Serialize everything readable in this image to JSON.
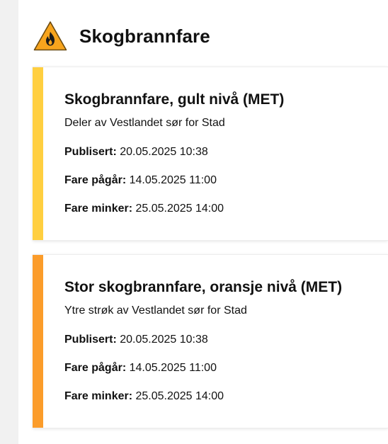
{
  "header": {
    "title": "Skogbrannfare",
    "icon": "fire-warning-icon"
  },
  "colors": {
    "yellow": "#ffcf40",
    "orange": "#fb9c2a",
    "icon_fill": "#f7a41d"
  },
  "warnings": [
    {
      "title": "Skogbrannfare, gult nivå (MET)",
      "area": "Deler av Vestlandet sør for Stad",
      "level_color": "yellow",
      "published_label": "Publisert:",
      "published_value": "20.05.2025 10:38",
      "ongoing_label": "Fare pågår:",
      "ongoing_value": "14.05.2025 11:00",
      "ends_label": "Fare minker:",
      "ends_value": "25.05.2025 14:00"
    },
    {
      "title": "Stor skogbrannfare, oransje nivå (MET)",
      "area": "Ytre strøk av Vestlandet sør for Stad",
      "level_color": "orange",
      "published_label": "Publisert:",
      "published_value": "20.05.2025 10:38",
      "ongoing_label": "Fare pågår:",
      "ongoing_value": "14.05.2025 11:00",
      "ends_label": "Fare minker:",
      "ends_value": "25.05.2025 14:00"
    }
  ]
}
